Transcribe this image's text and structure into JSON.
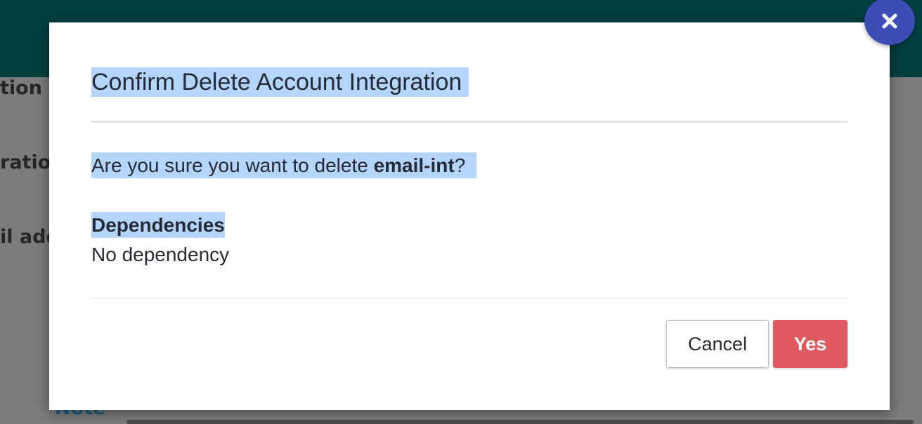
{
  "background": {
    "labels": [
      "tion F",
      "ration",
      "il add"
    ],
    "note": "Note"
  },
  "dialog": {
    "title": "Confirm Delete Account Integration",
    "question_prefix": "Are you sure you want to delete ",
    "item_name": "email-int",
    "question_suffix": "?",
    "dependencies_heading": "Dependencies",
    "dependencies_value": "No dependency",
    "cancel_label": "Cancel",
    "yes_label": "Yes",
    "close_icon": "close-icon"
  },
  "colors": {
    "header_bar": "#003f40",
    "close_button": "#3d4db5",
    "danger_button": "#df5a5e",
    "selection_highlight": "#b4d5fe"
  }
}
